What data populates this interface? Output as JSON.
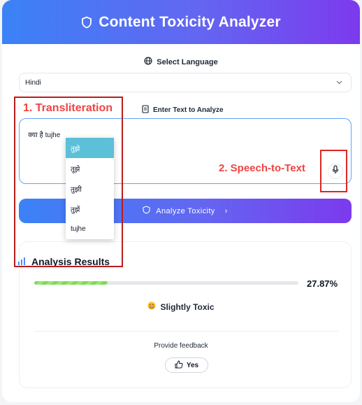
{
  "header": {
    "title": "Content Toxicity Analyzer",
    "icon": "shield-icon"
  },
  "language": {
    "label": "Select Language",
    "icon": "globe-icon",
    "selected": "Hindi"
  },
  "text_input": {
    "label": "Enter Text to Analyze",
    "icon": "document-icon",
    "value": "क्या है tujhe"
  },
  "transliteration": {
    "suggestions": [
      "तुझे",
      "तूझे",
      "तुझी",
      "तुझें",
      "tujhe"
    ],
    "active_index": 0
  },
  "analyze_button": {
    "label": "Analyze Toxicity",
    "icon": "shield-icon",
    "trailing": "›"
  },
  "results": {
    "title": "Analysis Results",
    "icon": "bar-chart-icon",
    "toxicity_percent": "27.87%",
    "toxicity_fraction": 0.2787,
    "verdict": "Slightly Toxic",
    "verdict_icon": "grimace-emoji-icon"
  },
  "feedback": {
    "label": "Provide feedback",
    "yes_label": "Yes",
    "yes_icon": "thumbs-up-icon"
  },
  "annotations": {
    "label1": "1. Transliteration",
    "label2": "2. Speech-to-Text"
  },
  "colors": {
    "accent_start": "#3b82f6",
    "accent_end": "#7c3aed",
    "annotation": "#ef4444",
    "active_suggestion": "#5bc0d8",
    "progress": "#7ed957"
  }
}
